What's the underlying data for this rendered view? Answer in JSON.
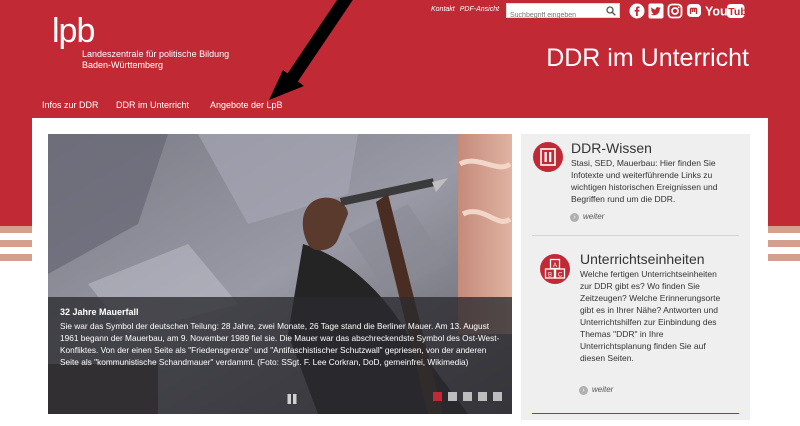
{
  "logo": {
    "mark": "lpb",
    "line1": "Landeszentrale für politische Bildung",
    "line2": "Baden-Württemberg"
  },
  "header": {
    "links": [
      "Kontakt",
      "PDF-Ansicht"
    ],
    "search_placeholder": "Suchbegriff eingeben",
    "social": [
      "facebook-icon",
      "twitter-icon",
      "instagram-icon",
      "mastodon-icon",
      "youtube-icon"
    ],
    "site_title": "DDR im Unterricht"
  },
  "nav": [
    "Infos zur DDR",
    "DDR im Unterricht",
    "Angebote der LpB"
  ],
  "slider": {
    "title": "32 Jahre Mauerfall",
    "text": "Sie war das Symbol der deutschen Teilung: 28 Jahre, zwei Monate, 26 Tage stand die Berliner Mauer. Am 13. August 1961 begann der Mauerbau, am 9. November 1989 fiel sie. Die Mauer war das abschreckendste Symbol des Ost-West-Konfliktes. Von der einen Seite als \"Friedensgrenze\" und \"Antifaschistischer Schutzwall\" gepriesen, von der anderen Seite als \"kommunistische Schandmauer\" verdammt. (Foto: SSgt. F. Lee Corkran, DoD, gemeinfrei, Wikimedia)",
    "slide_count": 5,
    "active_slide": 1
  },
  "sidebar": [
    {
      "title": "DDR-Wissen",
      "icon": "info-icon",
      "text": "Stasi, SED, Mauerbau: Hier finden Sie Infotexte und weiterführende Links zu wichtigen historischen Ereignissen und Begriffen rund um die DDR.",
      "more": "weiter"
    },
    {
      "title": "Unterrichtseinheiten",
      "icon": "abc-blocks-icon",
      "text": "Welche fertigen Unterrichtseinheiten zur DDR gibt es? Wo finden Sie Zeitzeugen? Welche Erinnerungsorte gibt es in Ihrer Nähe? Antworten und Unterrichtshilfen zur Einbindung des Themas \"DDR\" in Ihre Unterrichtsplanung finden Sie auf diesen Seiten.",
      "more": "weiter"
    }
  ],
  "colors": {
    "brand_red": "#c12a35",
    "stripe": "#d2a08d",
    "sidebar_bg": "#efefef"
  }
}
